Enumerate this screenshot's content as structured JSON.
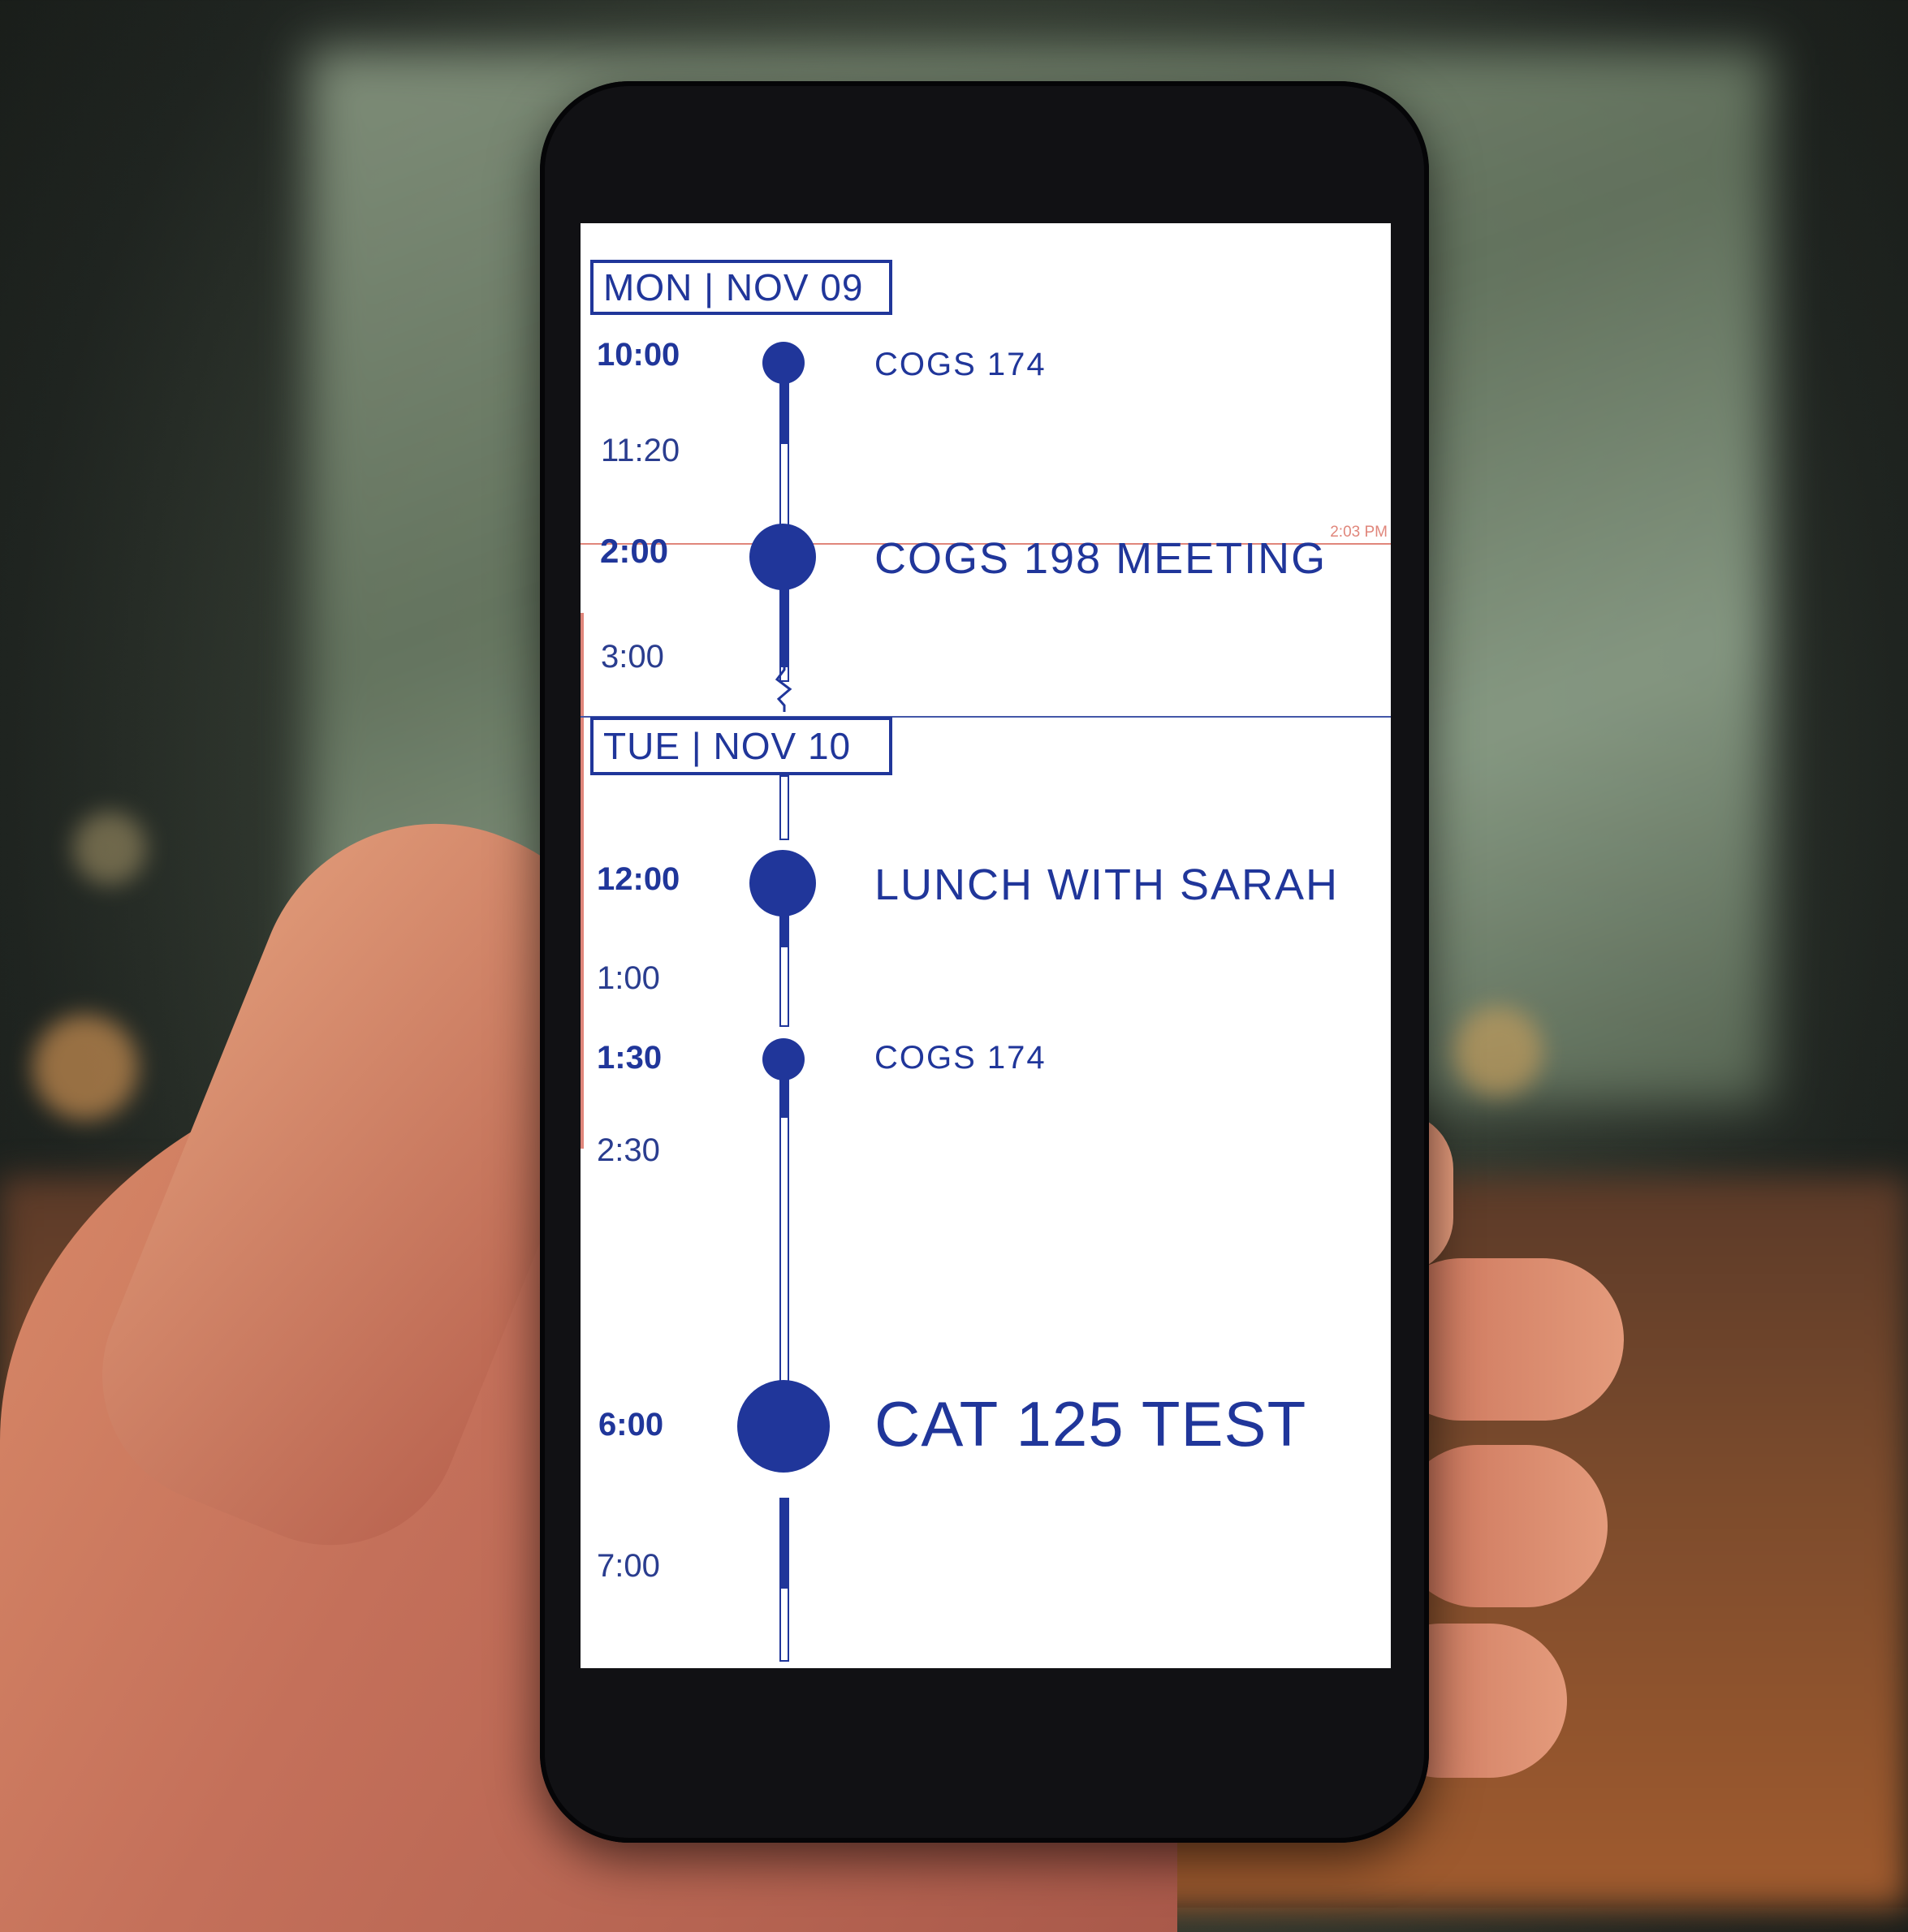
{
  "colors": {
    "accent": "#20369a",
    "now_indicator": "#e0867b",
    "screen_bg": "#ffffff"
  },
  "now_label": "2:03 PM",
  "days": [
    {
      "label": "MON | NOV 09",
      "events": [
        {
          "start": "10:00",
          "end": "11:20",
          "title": "COGS 174"
        },
        {
          "start": "2:00",
          "end": "3:00",
          "title": "COGS 198 MEETING"
        }
      ]
    },
    {
      "label": "TUE | NOV 10",
      "events": [
        {
          "start": "12:00",
          "end": "1:00",
          "title": "LUNCH WITH SARAH"
        },
        {
          "start": "1:30",
          "end": "2:30",
          "title": "COGS 174"
        },
        {
          "start": "6:00",
          "end": "7:00",
          "title": "CAT 125 TEST"
        }
      ]
    }
  ]
}
